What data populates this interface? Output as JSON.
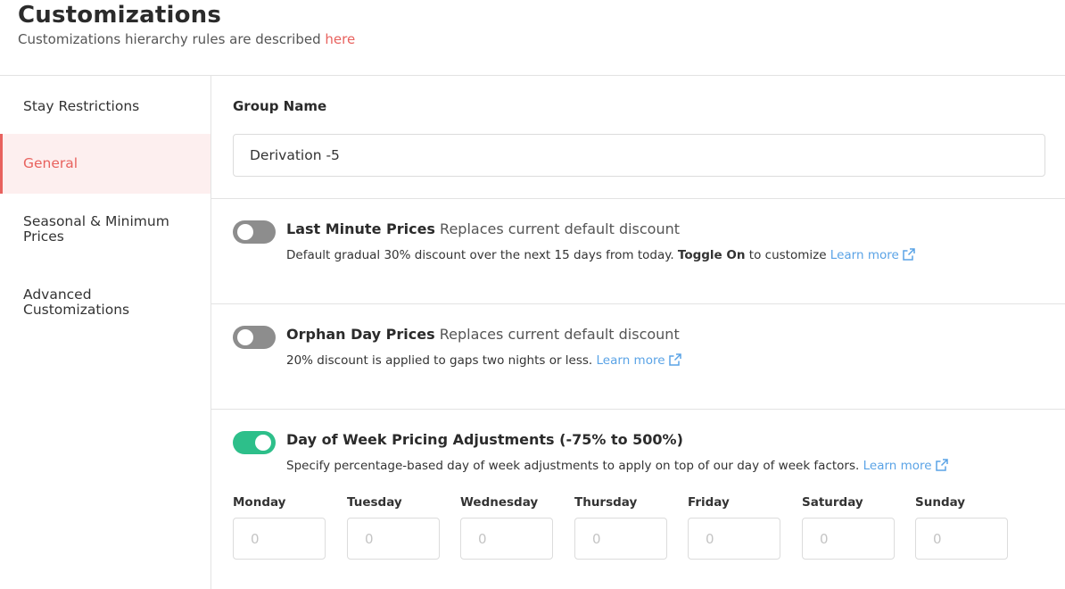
{
  "header": {
    "title": "Customizations",
    "subtitle": "Customizations hierarchy rules are described",
    "subtitle_link": "here"
  },
  "sidebar": {
    "items": [
      {
        "label": "Stay Restrictions",
        "active": false
      },
      {
        "label": "General",
        "active": true
      },
      {
        "label": "Seasonal & Minimum Prices",
        "active": false
      },
      {
        "label": "Advanced Customizations",
        "active": false
      }
    ]
  },
  "group": {
    "label": "Group Name",
    "value": "Derivation -5"
  },
  "last_minute": {
    "enabled": false,
    "title": "Last Minute Prices",
    "subtitle": "Replaces current default discount",
    "desc_before": "Default gradual 30% discount over the next 15 days from today.",
    "desc_bold": "Toggle On",
    "desc_after": "to customize",
    "link": "Learn more"
  },
  "orphan_day": {
    "enabled": false,
    "title": "Orphan Day Prices",
    "subtitle": "Replaces current default discount",
    "desc": "20% discount is applied to gaps two nights or less.",
    "link": "Learn more"
  },
  "day_of_week": {
    "enabled": true,
    "title": "Day of Week Pricing Adjustments (-75% to 500%)",
    "desc": "Specify percentage-based day of week adjustments to apply on top of our day of week factors.",
    "link": "Learn more",
    "days": [
      {
        "label": "Monday",
        "placeholder": "0"
      },
      {
        "label": "Tuesday",
        "placeholder": "0"
      },
      {
        "label": "Wednesday",
        "placeholder": "0"
      },
      {
        "label": "Thursday",
        "placeholder": "0"
      },
      {
        "label": "Friday",
        "placeholder": "0"
      },
      {
        "label": "Saturday",
        "placeholder": "0"
      },
      {
        "label": "Sunday",
        "placeholder": "0"
      }
    ]
  },
  "colors": {
    "accent": "#e8625e",
    "toggle_on": "#2dbf8a",
    "toggle_off": "#8d8d8d",
    "link": "#5aa3e6"
  }
}
